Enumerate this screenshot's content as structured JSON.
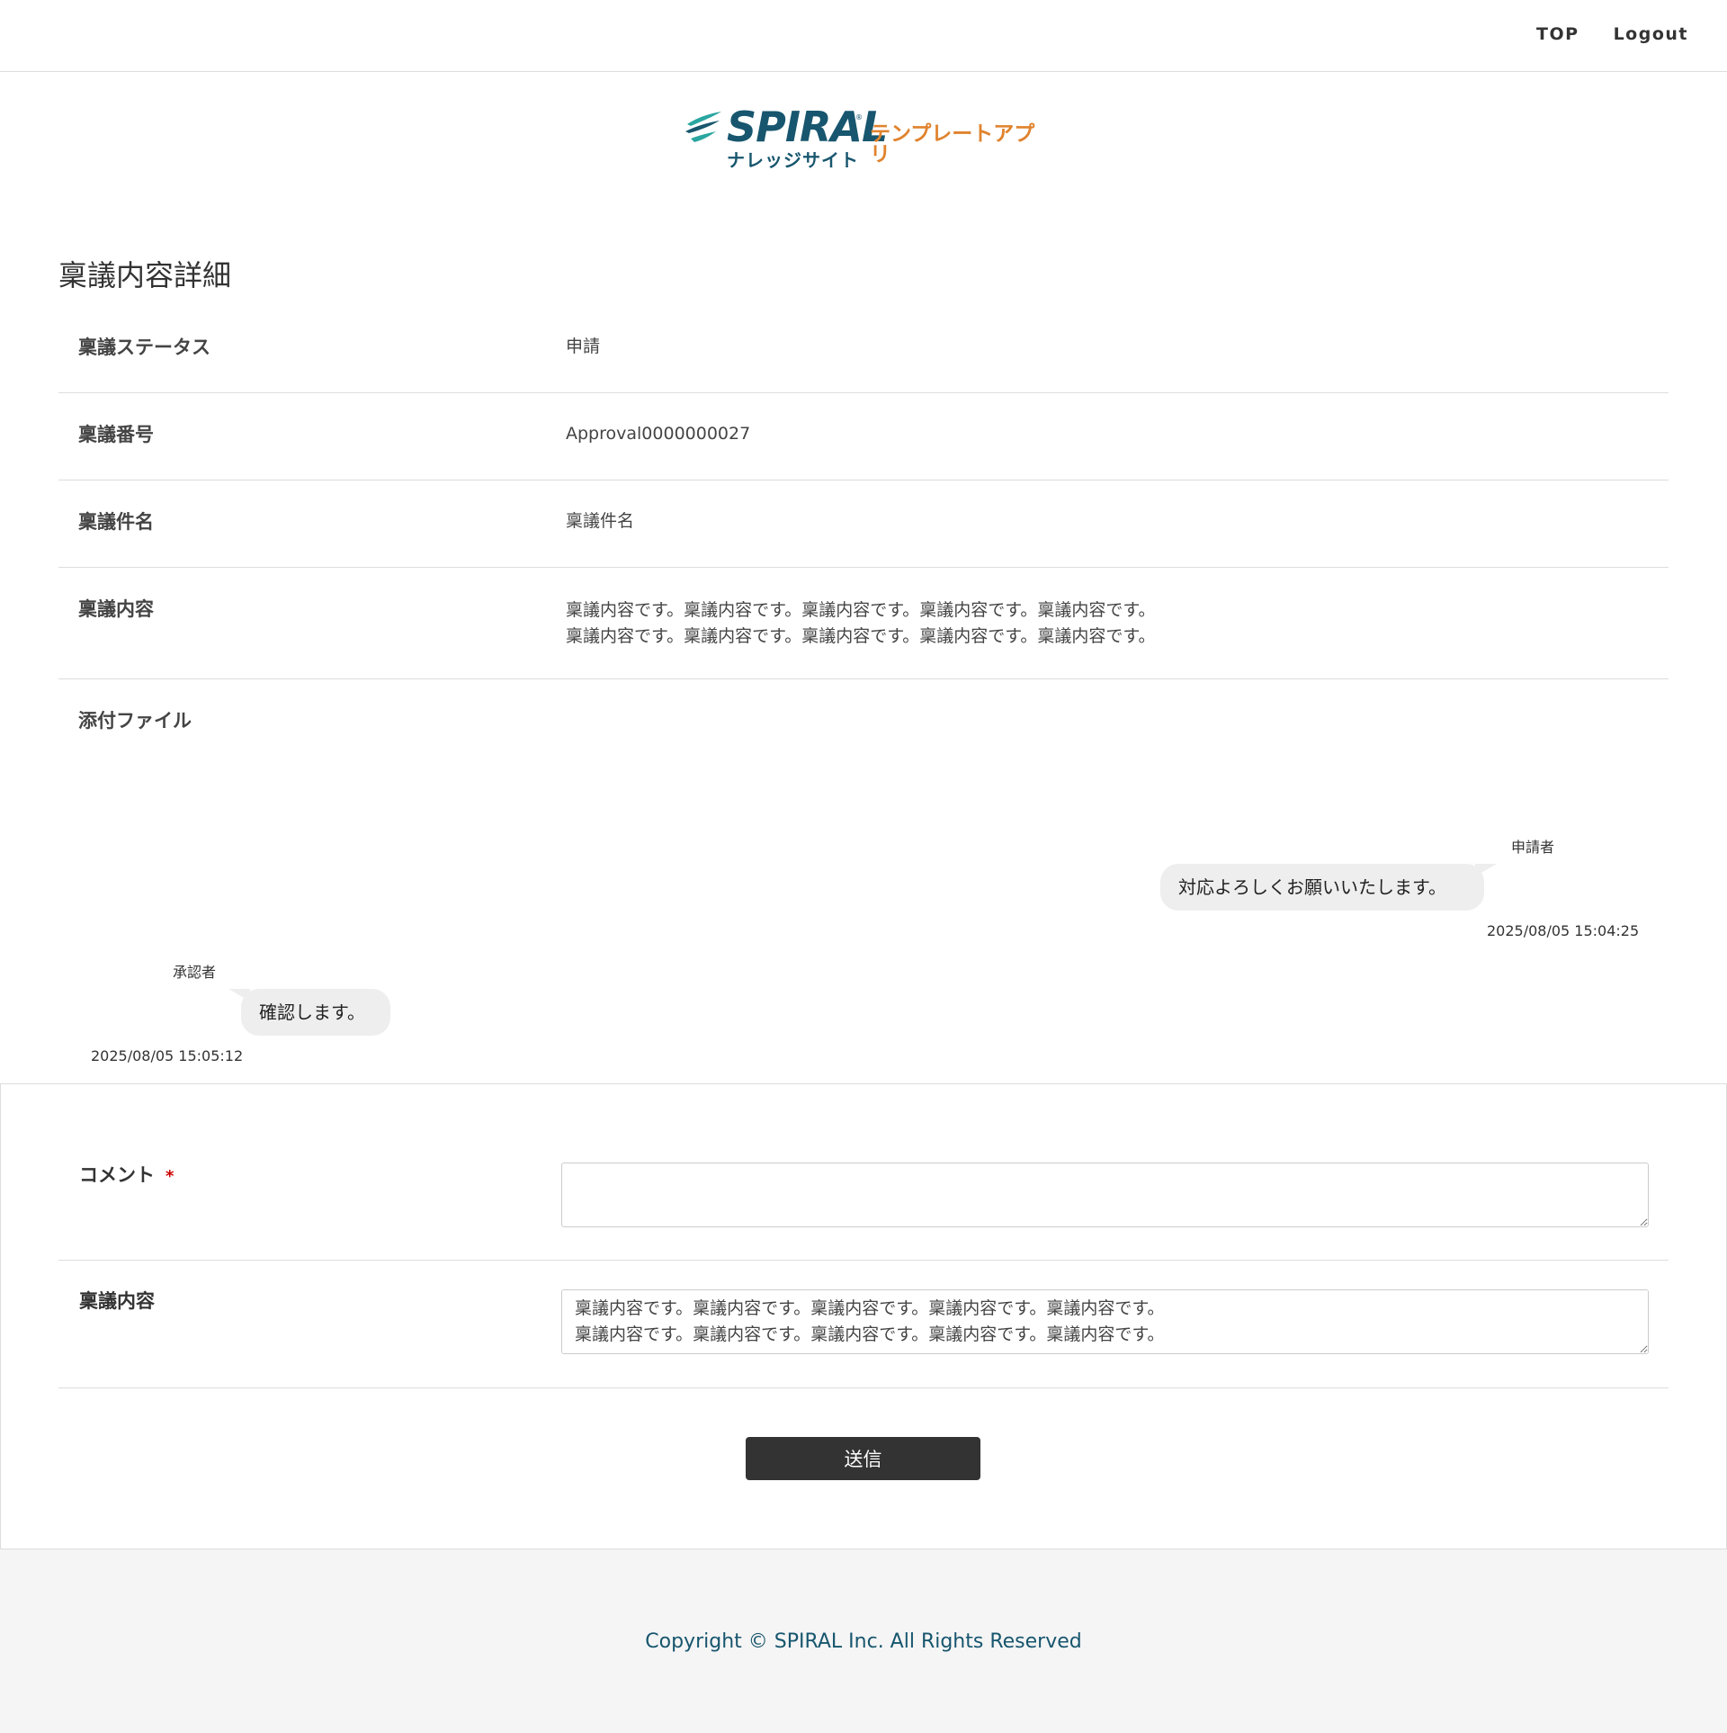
{
  "nav": {
    "top_label": "TOP",
    "logout_label": "Logout"
  },
  "logo": {
    "main": "SPIRAL",
    "reg": "®",
    "sub": "ナレッジサイト",
    "app": "テンプレートアプリ",
    "colors": {
      "primary": "#17566e",
      "accent": "#e0832e",
      "teal": "#2aa6a0"
    }
  },
  "page_title": "稟議内容詳細",
  "details": [
    {
      "label": "稟議ステータス",
      "value": "申請"
    },
    {
      "label": "稟議番号",
      "value": "Approval0000000027"
    },
    {
      "label": "稟議件名",
      "value": "稟議件名"
    },
    {
      "label": "稟議内容",
      "value": "稟議内容です。稟議内容です。稟議内容です。稟議内容です。稟議内容です。\n稟議内容です。稟議内容です。稟議内容です。稟議内容です。稟議内容です。"
    },
    {
      "label": "添付ファイル",
      "value": ""
    }
  ],
  "messages": [
    {
      "sender": "申請者",
      "text": "対応よろしくお願いいたします。",
      "time": "2025/08/05 15:04:25"
    },
    {
      "sender": "承認者",
      "text": "確認します。",
      "time": "2025/08/05 15:05:12"
    }
  ],
  "form": {
    "comment_label": "コメント",
    "required_mark": "*",
    "comment_value": "",
    "content_label": "稟議内容",
    "content_value": "稟議内容です。稟議内容です。稟議内容です。稟議内容です。稟議内容です。\n稟議内容です。稟議内容です。稟議内容です。稟議内容です。稟議内容です。",
    "submit_label": "送信"
  },
  "footer": {
    "copyright": "Copyright © SPIRAL Inc. All Rights Reserved"
  }
}
